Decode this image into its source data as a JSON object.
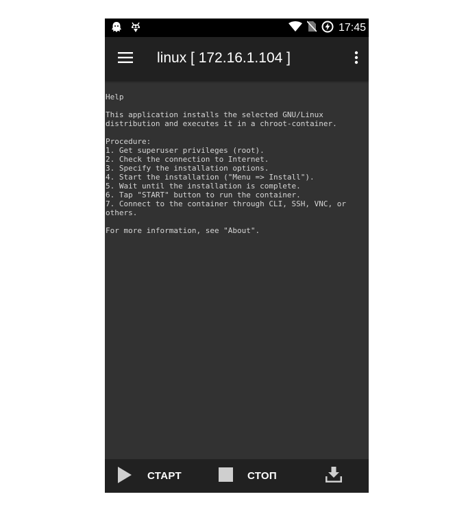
{
  "status_bar": {
    "left_icons": [
      "ghost-icon",
      "bug-droid-icon"
    ],
    "right_icons": [
      "wifi-icon",
      "no-sim-icon",
      "data-saver-icon"
    ],
    "time": "17:45"
  },
  "app_bar": {
    "title": "linux  [ 172.16.1.104 ]",
    "menu_icon": "hamburger-menu-icon",
    "overflow_icon": "more-vert-icon"
  },
  "console": {
    "text": "Help\n\nThis application installs the selected GNU/Linux\ndistribution and executes it in a chroot-container.\n\nProcedure:\n1. Get superuser privileges (root).\n2. Check the connection to Internet.\n3. Specify the installation options.\n4. Start the installation (\"Menu => Install\").\n5. Wait until the installation is complete.\n6. Tap \"START\" button to run the container.\n7. Connect to the container through CLI, SSH, VNC, or\nothers.\n\nFor more information, see \"About\"."
  },
  "bottom_bar": {
    "start_label": "СТАРТ",
    "stop_label": "СТОП",
    "start_icon": "play-icon",
    "stop_icon": "stop-icon",
    "install_icon": "download-icon"
  },
  "colors": {
    "status_bar": "#000000",
    "app_bar": "#212121",
    "content_bg": "#323232",
    "console_text": "#d6d6d6",
    "bottom_bar": "#212121",
    "icon_gray": "#cfcfcf"
  }
}
